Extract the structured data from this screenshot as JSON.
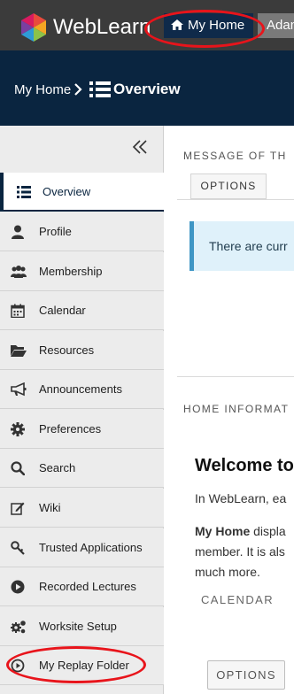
{
  "topbar": {
    "brand": "WebLearn",
    "home_button": "My Home",
    "user_name": "Adam",
    "colors": {
      "bar": "#3b3b3b",
      "home_button": "#0f2a4a"
    }
  },
  "breadcrumb": {
    "home": "My Home",
    "current": "Overview"
  },
  "sidebar": {
    "collapse_icon": "double-chevron-left-icon",
    "items": [
      {
        "label": "Overview",
        "icon": "list-icon",
        "active": true
      },
      {
        "label": "Profile",
        "icon": "user-icon"
      },
      {
        "label": "Membership",
        "icon": "users-icon"
      },
      {
        "label": "Calendar",
        "icon": "calendar-icon"
      },
      {
        "label": "Resources",
        "icon": "folder-open-icon"
      },
      {
        "label": "Announcements",
        "icon": "bullhorn-icon"
      },
      {
        "label": "Preferences",
        "icon": "gear-icon"
      },
      {
        "label": "Search",
        "icon": "search-icon"
      },
      {
        "label": "Wiki",
        "icon": "edit-icon"
      },
      {
        "label": "Trusted Applications",
        "icon": "key-icon"
      },
      {
        "label": "Recorded Lectures",
        "icon": "play-circle-icon"
      },
      {
        "label": "Worksite Setup",
        "icon": "gears-icon"
      },
      {
        "label": "My Replay Folder",
        "icon": "play-circle-icon"
      }
    ]
  },
  "main": {
    "motd_title": "MESSAGE OF TH",
    "options_label": "OPTIONS",
    "alert_text": "There are curr",
    "home_info_title": "HOME INFORMAT",
    "welcome": "Welcome to",
    "intro": "In WebLearn, ea",
    "para_bold": "My Home",
    "para_rest": " displa",
    "para_line2": "member. It is als",
    "para_line3": "much more.",
    "calendar_title": "CALENDAR",
    "bottom_options_label": "OPTIONS"
  },
  "annotations": {
    "highlight_color": "#e8141b"
  }
}
